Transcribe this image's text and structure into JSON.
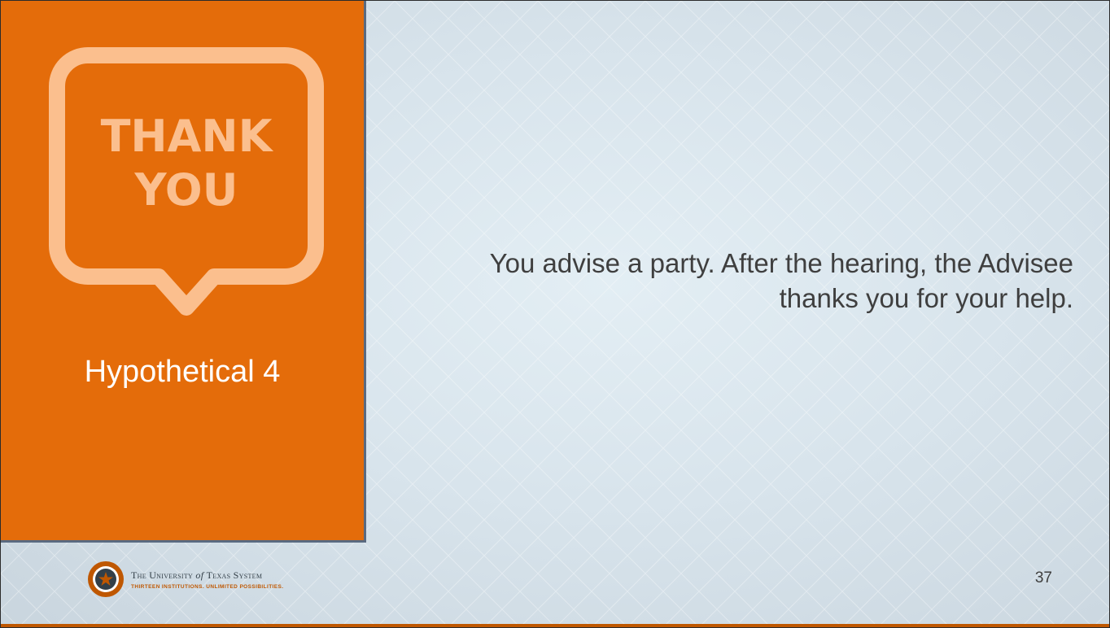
{
  "slide": {
    "bubble_line1": "THANK",
    "bubble_line2": "YOU",
    "title": "Hypothetical 4",
    "body": "You advise a party. After the hearing, the Advisee thanks you for your help.",
    "page_number": "37"
  },
  "footer": {
    "org_name_prefix": "The University",
    "org_name_of": "of",
    "org_name_suffix": "Texas System",
    "tagline": "THIRTEEN INSTITUTIONS. UNLIMITED POSSIBILITIES."
  },
  "colors": {
    "panel_orange": "#e46c0a",
    "bubble_peach": "#fbbf8e",
    "text_gray": "#3f3f3f",
    "ut_burnt_orange": "#bf5700"
  },
  "icons": {
    "bubble": "speech-bubble-icon",
    "seal": "university-seal-icon"
  }
}
